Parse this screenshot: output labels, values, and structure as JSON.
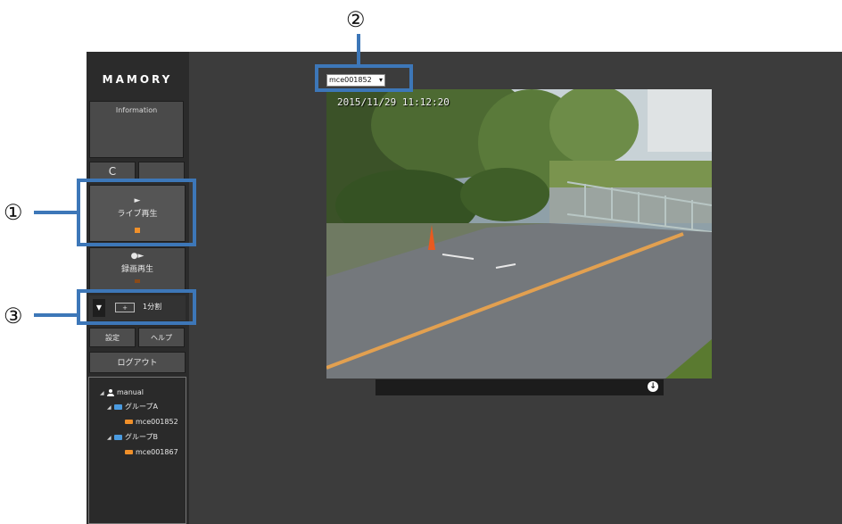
{
  "app": {
    "brand": "MAMORY",
    "information_label": "Information"
  },
  "controls": {
    "refresh_glyph": "C",
    "live_play": {
      "glyph": "►",
      "label": "ライブ再生"
    },
    "rec_play": {
      "glyph": "●►",
      "label": "録画再生"
    },
    "split": {
      "toggle_glyph": "▼",
      "box": "+",
      "label": "1分割"
    },
    "settings_label": "設定",
    "help_label": "ヘルプ",
    "logout_label": "ログアウト"
  },
  "tree": {
    "user": "manual",
    "groups": [
      {
        "name": "グループA",
        "cameras": [
          "mce001852"
        ]
      },
      {
        "name": "グループB",
        "cameras": [
          "mce001867"
        ]
      }
    ]
  },
  "camera_select": {
    "value": "mce001852"
  },
  "video": {
    "timestamp": "2015/11/29  11:12:20"
  },
  "callouts": [
    "①",
    "②",
    "③"
  ],
  "colors": {
    "callout": "#3d77b8",
    "background": "#3c3c3c",
    "sidebar": "#2b2b2b",
    "indicator": "#f0902a",
    "folder": "#4a9be0"
  },
  "icons": {
    "user": "user-icon",
    "folder": "folder-icon",
    "camera": "camera-icon",
    "download": "download-icon"
  }
}
